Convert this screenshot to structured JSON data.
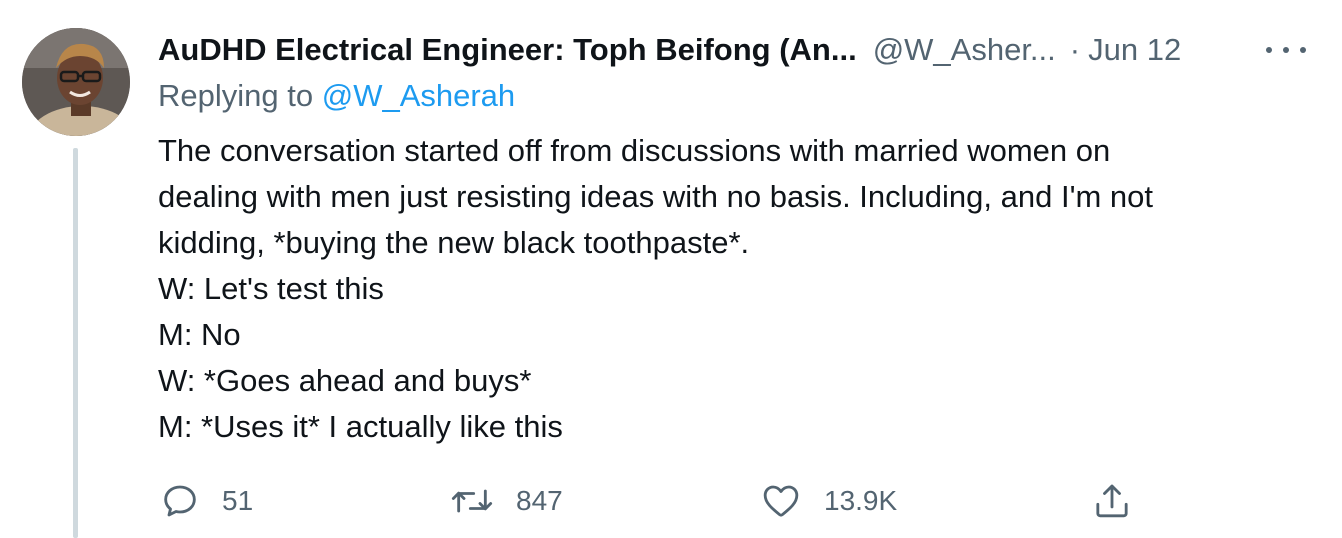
{
  "tweet": {
    "display_name": "AuDHD Electrical Engineer: Toph Beifong (An...",
    "handle": "@W_Asher...",
    "separator": "·",
    "date": "Jun 12",
    "replying_prefix": "Replying to ",
    "replying_handle": "@W_Asherah",
    "body_lines": [
      "The conversation started off from discussions with married women on",
      "dealing with men just resisting ideas with no basis. Including, and I'm not",
      "kidding, *buying the new black toothpaste*.",
      "W: Let's test this",
      "M: No",
      "W: *Goes ahead and buys*",
      "M: *Uses it* I actually like this"
    ],
    "actions": {
      "reply_count": "51",
      "retweet_count": "847",
      "like_count": "13.9K"
    }
  },
  "icons": {
    "reply": "reply-bubble-icon",
    "retweet": "retweet-icon",
    "like": "heart-icon",
    "share": "share-icon",
    "more": "more-dots-icon"
  },
  "colors": {
    "text_primary": "#0f1419",
    "text_secondary": "#536471",
    "link": "#1d9bf0",
    "thread_line": "#cfd9de"
  }
}
